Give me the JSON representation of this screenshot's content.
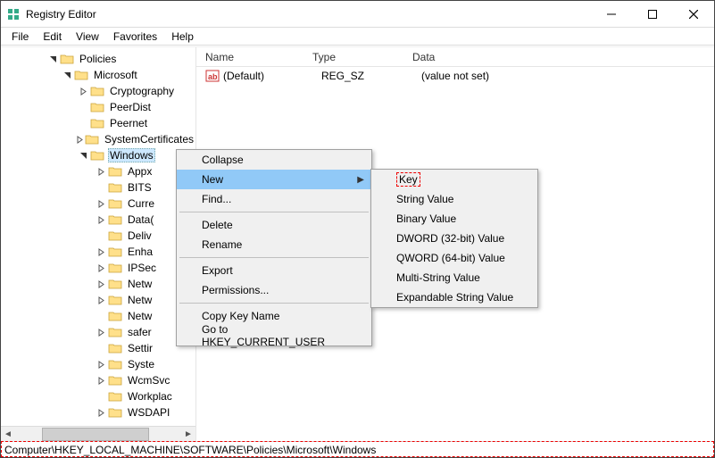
{
  "window": {
    "title": "Registry Editor"
  },
  "menubar": {
    "items": [
      "File",
      "Edit",
      "View",
      "Favorites",
      "Help"
    ]
  },
  "tree": {
    "top": {
      "label": "Policies",
      "expanded": true
    },
    "microsoft": {
      "label": "Microsoft",
      "expanded": true
    },
    "children": [
      {
        "label": "Cryptography",
        "hasChildren": true
      },
      {
        "label": "PeerDist"
      },
      {
        "label": "Peernet"
      },
      {
        "label": "SystemCertificates",
        "hasChildren": true
      },
      {
        "label": "Windows",
        "expanded": true,
        "selected": true
      }
    ],
    "windowsChildren": [
      {
        "label": "Appx",
        "hasChildren": true,
        "clipped": true
      },
      {
        "label": "BITS"
      },
      {
        "label": "CurrentVersion",
        "hasChildren": true,
        "clipped": "Curre"
      },
      {
        "label": "DataCollection",
        "hasChildren": true,
        "clipped": "Data("
      },
      {
        "label": "DeliveryOptimization",
        "clipped": "Deliv"
      },
      {
        "label": "EnhancedStorageDevices",
        "hasChildren": true,
        "clipped": "Enha"
      },
      {
        "label": "IPSec",
        "hasChildren": true,
        "clipped": "IPSec"
      },
      {
        "label": "NetworkConnectivityStatusIndicator",
        "hasChildren": true,
        "clipped": "Netw"
      },
      {
        "label": "NetworkProvider",
        "hasChildren": true,
        "clipped": "Netw"
      },
      {
        "label": "NetworkIsolation",
        "clipped": "Netw"
      },
      {
        "label": "safer",
        "hasChildren": true,
        "clipped": "safer"
      },
      {
        "label": "Settings",
        "clipped": "Settir"
      },
      {
        "label": "System",
        "hasChildren": true,
        "clipped": "Syste"
      },
      {
        "label": "WcmSvc",
        "hasChildren": true,
        "clipped": "WcmSvc"
      },
      {
        "label": "WorkplaceJoin",
        "clipped": "Workplac"
      },
      {
        "label": "WSDAPI",
        "hasChildren": true,
        "clipped": "WSDAPI"
      }
    ]
  },
  "list": {
    "headers": {
      "name": "Name",
      "type": "Type",
      "data": "Data"
    },
    "rows": [
      {
        "name": "(Default)",
        "type": "REG_SZ",
        "data": "(value not set)"
      }
    ]
  },
  "contextMenu": {
    "items": [
      {
        "label": "Collapse"
      },
      {
        "label": "New",
        "submenu": true,
        "hover": true
      },
      {
        "label": "Find..."
      },
      {
        "sep": true
      },
      {
        "label": "Delete"
      },
      {
        "label": "Rename"
      },
      {
        "sep": true
      },
      {
        "label": "Export"
      },
      {
        "label": "Permissions..."
      },
      {
        "sep": true
      },
      {
        "label": "Copy Key Name"
      },
      {
        "label": "Go to HKEY_CURRENT_USER"
      }
    ],
    "submenuItems": [
      {
        "label": "Key",
        "highlight": true
      },
      {
        "sep": true
      },
      {
        "label": "String Value"
      },
      {
        "label": "Binary Value"
      },
      {
        "label": "DWORD (32-bit) Value"
      },
      {
        "label": "QWORD (64-bit) Value"
      },
      {
        "label": "Multi-String Value"
      },
      {
        "label": "Expandable String Value"
      }
    ]
  },
  "statusbar": {
    "path": "Computer\\HKEY_LOCAL_MACHINE\\SOFTWARE\\Policies\\Microsoft\\Windows"
  }
}
